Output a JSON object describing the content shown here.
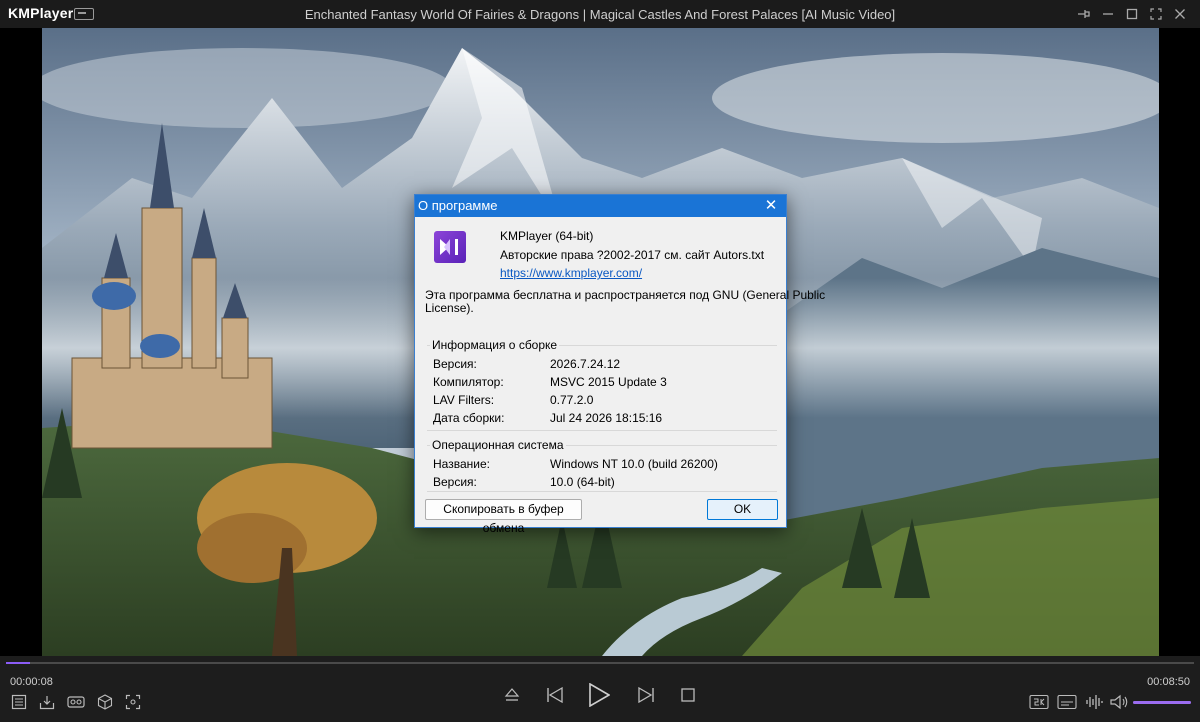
{
  "titlebar": {
    "logo": "KMPlayer",
    "title": "Enchanted Fantasy World Of Fairies & Dragons | Magical Castles And Forest Palaces [AI Music Video]"
  },
  "dialog": {
    "title": "О программе",
    "app_name": "KMPlayer (64-bit)",
    "copyright": "Авторские права ?2002-2017 см. сайт Autors.txt",
    "url": "https://www.kmplayer.com/",
    "license_line1": "Эта программа бесплатна и распространяется под GNU (General Public",
    "license_line2": "License).",
    "build_group": {
      "title": "Информация о сборке",
      "rows": [
        {
          "label": "Версия:",
          "value": "2026.7.24.12"
        },
        {
          "label": "Компилятор:",
          "value": "MSVC 2015 Update 3"
        },
        {
          "label": "LAV Filters:",
          "value": "0.77.2.0"
        },
        {
          "label": "Дата сборки:",
          "value": "Jul 24 2026 18:15:16"
        }
      ]
    },
    "os_group": {
      "title": "Операционная система",
      "rows": [
        {
          "label": "Название:",
          "value": "Windows NT 10.0 (build 26200)"
        },
        {
          "label": "Версия:",
          "value": "10.0 (64-bit)"
        }
      ]
    },
    "copy_button": "Скопировать в буфер обмена",
    "ok_button": "OK"
  },
  "player": {
    "elapsed": "00:00:08",
    "duration": "00:08:50",
    "progress_fraction": 0.02,
    "volume_fraction": 1.0,
    "accent_color": "#8b5cf6"
  }
}
